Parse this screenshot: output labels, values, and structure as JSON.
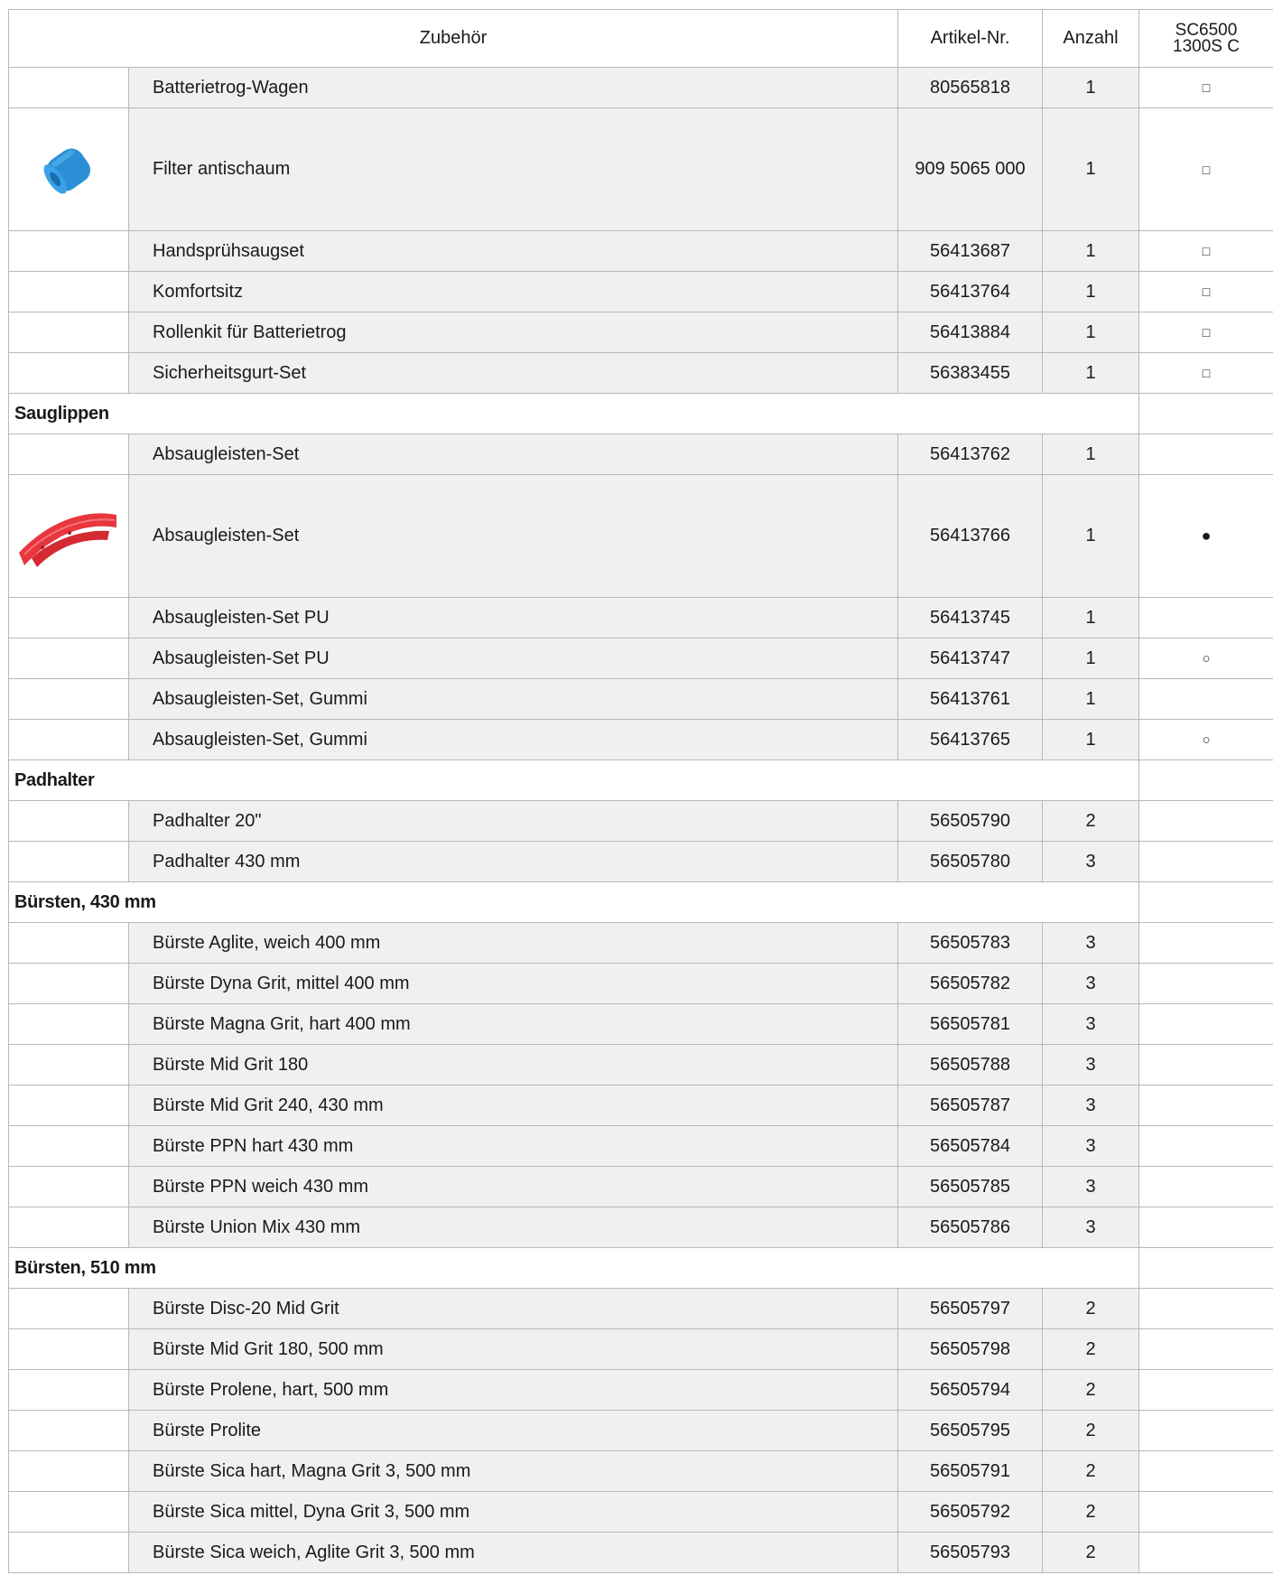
{
  "header": {
    "col_name": "Zubehör",
    "col_art": "Artikel-Nr.",
    "col_qty": "Anzahl",
    "col_model_line1": "SC6500",
    "col_model_line2": "1300S C"
  },
  "colors": {
    "row_bg": "#f0f0f0",
    "border": "#b8b8b8",
    "filter_blue": "#2a8fd6",
    "squeegee_red": "#e8363e"
  },
  "items": [
    {
      "name": "Batterietrog-Wagen",
      "art": "80565818",
      "qty": "1",
      "avail": "□"
    },
    {
      "name": "Filter antischaum",
      "art": "909 5065 000",
      "qty": "1",
      "avail": "□",
      "icon": "blue-foam-filter-image"
    },
    {
      "name": "Handsprühsaugset",
      "art": "56413687",
      "qty": "1",
      "avail": "□"
    },
    {
      "name": "Komfortsitz",
      "art": "56413764",
      "qty": "1",
      "avail": "□"
    },
    {
      "name": "Rollenkit für Batterietrog",
      "art": "56413884",
      "qty": "1",
      "avail": "□"
    },
    {
      "name": "Sicherheitsgurt-Set",
      "art": "56383455",
      "qty": "1",
      "avail": "□"
    },
    {
      "category": "Sauglippen"
    },
    {
      "name": "Absaugleisten-Set",
      "art": "56413762",
      "qty": "1",
      "avail": ""
    },
    {
      "name": "Absaugleisten-Set",
      "art": "56413766",
      "qty": "1",
      "avail": "●",
      "icon": "red-squeegee-blade-image"
    },
    {
      "name": "Absaugleisten-Set PU",
      "art": "56413745",
      "qty": "1",
      "avail": ""
    },
    {
      "name": "Absaugleisten-Set PU",
      "art": "56413747",
      "qty": "1",
      "avail": "○"
    },
    {
      "name": "Absaugleisten-Set, Gummi",
      "art": "56413761",
      "qty": "1",
      "avail": ""
    },
    {
      "name": "Absaugleisten-Set, Gummi",
      "art": "56413765",
      "qty": "1",
      "avail": "○"
    },
    {
      "category": "Padhalter"
    },
    {
      "name": "Padhalter 20\"",
      "art": "56505790",
      "qty": "2",
      "avail": ""
    },
    {
      "name": "Padhalter 430 mm",
      "art": "56505780",
      "qty": "3",
      "avail": ""
    },
    {
      "category": "Bürsten, 430 mm"
    },
    {
      "name": "Bürste Aglite, weich 400 mm",
      "art": "56505783",
      "qty": "3",
      "avail": ""
    },
    {
      "name": "Bürste Dyna Grit, mittel 400 mm",
      "art": "56505782",
      "qty": "3",
      "avail": ""
    },
    {
      "name": "Bürste Magna Grit, hart 400 mm",
      "art": "56505781",
      "qty": "3",
      "avail": ""
    },
    {
      "name": "Bürste Mid Grit 180",
      "art": "56505788",
      "qty": "3",
      "avail": ""
    },
    {
      "name": "Bürste Mid Grit 240, 430 mm",
      "art": "56505787",
      "qty": "3",
      "avail": ""
    },
    {
      "name": "Bürste PPN hart 430 mm",
      "art": "56505784",
      "qty": "3",
      "avail": ""
    },
    {
      "name": "Bürste PPN weich 430 mm",
      "art": "56505785",
      "qty": "3",
      "avail": ""
    },
    {
      "name": "Bürste Union Mix 430 mm",
      "art": "56505786",
      "qty": "3",
      "avail": ""
    },
    {
      "category": "Bürsten, 510 mm"
    },
    {
      "name": "Bürste Disc-20 Mid Grit",
      "art": "56505797",
      "qty": "2",
      "avail": ""
    },
    {
      "name": "Bürste Mid Grit 180, 500 mm",
      "art": "56505798",
      "qty": "2",
      "avail": ""
    },
    {
      "name": "Bürste Prolene, hart, 500 mm",
      "art": "56505794",
      "qty": "2",
      "avail": ""
    },
    {
      "name": "Bürste Prolite",
      "art": "56505795",
      "qty": "2",
      "avail": ""
    },
    {
      "name": "Bürste Sica hart, Magna Grit 3, 500 mm",
      "art": "56505791",
      "qty": "2",
      "avail": ""
    },
    {
      "name": "Bürste Sica mittel, Dyna Grit 3, 500 mm",
      "art": "56505792",
      "qty": "2",
      "avail": ""
    },
    {
      "name": "Bürste Sica weich, Aglite Grit 3, 500 mm",
      "art": "56505793",
      "qty": "2",
      "avail": ""
    }
  ]
}
